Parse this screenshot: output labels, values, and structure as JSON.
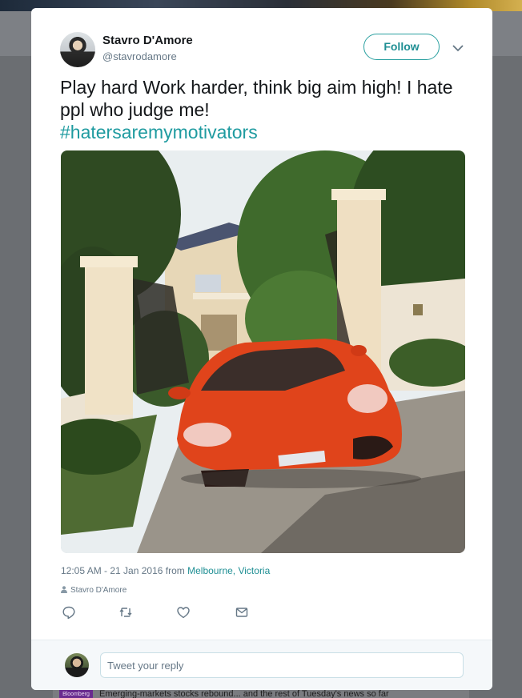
{
  "tweet": {
    "author_name": "Stavro D'Amore",
    "author_handle": "@stavrodamore",
    "follow_label": "Follow",
    "text": "Play hard Work harder, think big aim high! I hate ppl who judge me!",
    "hashtag": "#hatersaremymotivators",
    "time": "12:05 AM - 21 Jan 2016 from",
    "location": "Melbourne, Victoria",
    "photo_credit": "Stavro D'Amore"
  },
  "actions": [
    {
      "name": "reply-icon"
    },
    {
      "name": "retweet-icon"
    },
    {
      "name": "like-icon"
    },
    {
      "name": "message-icon"
    }
  ],
  "reply": {
    "placeholder": "Tweet your reply"
  },
  "background": {
    "news_source": "Bloomberg",
    "news_text": "Emerging-markets stocks rebound... and the rest of Tuesday's news so far"
  },
  "colors": {
    "accent": "#1f8f94",
    "text": "#14171a",
    "muted": "#657786"
  }
}
